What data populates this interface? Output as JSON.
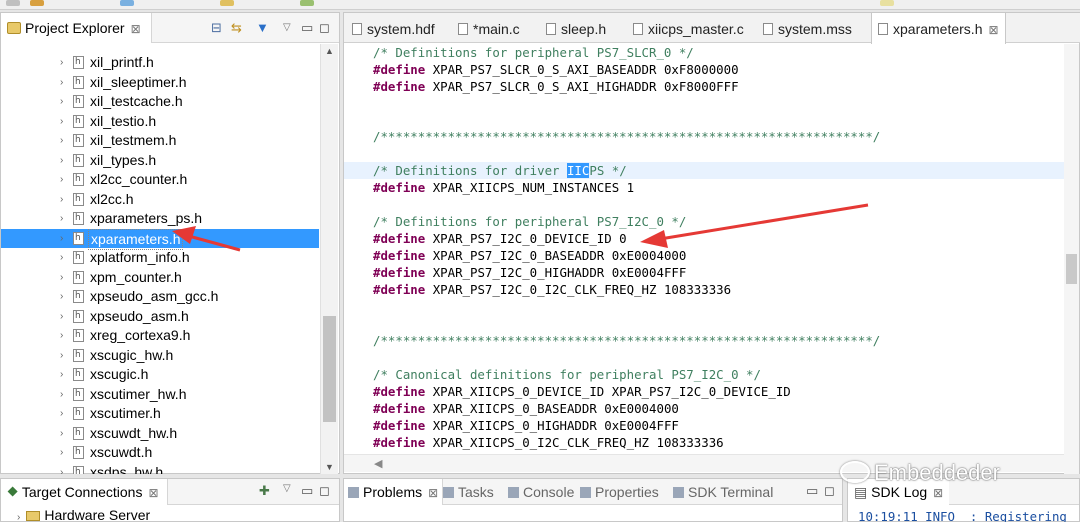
{
  "project_explorer": {
    "title": "Project Explorer",
    "close_glyph": "⊠",
    "files": [
      "xil_printf.h",
      "xil_sleeptimer.h",
      "xil_testcache.h",
      "xil_testio.h",
      "xil_testmem.h",
      "xil_types.h",
      "xl2cc_counter.h",
      "xl2cc.h",
      "xparameters_ps.h",
      "xparameters.h",
      "xplatform_info.h",
      "xpm_counter.h",
      "xpseudo_asm_gcc.h",
      "xpseudo_asm.h",
      "xreg_cortexa9.h",
      "xscugic_hw.h",
      "xscugic.h",
      "xscutimer_hw.h",
      "xscutimer.h",
      "xscuwdt_hw.h",
      "xscuwdt.h",
      "xsdps_hw.h"
    ],
    "selected_file": "xparameters.h"
  },
  "editor": {
    "tabs": [
      {
        "label": "system.hdf"
      },
      {
        "label": "*main.c"
      },
      {
        "label": "sleep.h"
      },
      {
        "label": "xiicps_master.c"
      },
      {
        "label": "system.mss"
      },
      {
        "label": "xparameters.h",
        "active": true
      }
    ],
    "lines": {
      "l1": "/* Definitions for peripheral PS7_SLCR_0 */",
      "l2": "XPAR_PS7_SLCR_0_S_AXI_BASEADDR 0xF8000000",
      "l3": "XPAR_PS7_SLCR_0_S_AXI_HIGHADDR 0xF8000FFF",
      "l4": "/******************************************************************/",
      "l5a": "/* Definitions for driver ",
      "l5sel": "IIC",
      "l5b": "PS */",
      "l6": "XPAR_XIICPS_NUM_INSTANCES 1",
      "l7": "/* Definitions for peripheral PS7_I2C_0 */",
      "l8": "XPAR_PS7_I2C_0_DEVICE_ID 0",
      "l9": "XPAR_PS7_I2C_0_BASEADDR 0xE0004000",
      "l10": "XPAR_PS7_I2C_0_HIGHADDR 0xE0004FFF",
      "l11": "XPAR_PS7_I2C_0_I2C_CLK_FREQ_HZ 108333336",
      "l12": "/******************************************************************/",
      "l13": "/* Canonical definitions for peripheral PS7_I2C_0 */",
      "l14": "XPAR_XIICPS_0_DEVICE_ID XPAR_PS7_I2C_0_DEVICE_ID",
      "l15": "XPAR_XIICPS_0_BASEADDR 0xE0004000",
      "l16": "XPAR_XIICPS_0_HIGHADDR 0xE0004FFF",
      "l17": "XPAR_XIICPS_0_I2C_CLK_FREQ_HZ 108333336"
    },
    "define_keyword": "#define"
  },
  "target_connections": {
    "title": "Target Connections",
    "item": "Hardware Server"
  },
  "console_panel": {
    "tabs": [
      "Problems",
      "Tasks",
      "Console",
      "Properties",
      "SDK Terminal"
    ]
  },
  "sdk_log": {
    "title": "SDK Log",
    "line": "10:19:11 INFO  : Registering"
  },
  "watermark": {
    "text": "Embeddeder"
  },
  "colors": {
    "comment": "#3f7f5f",
    "keyword": "#7f0055",
    "selection": "#3399ff",
    "arrow": "#e53935"
  }
}
